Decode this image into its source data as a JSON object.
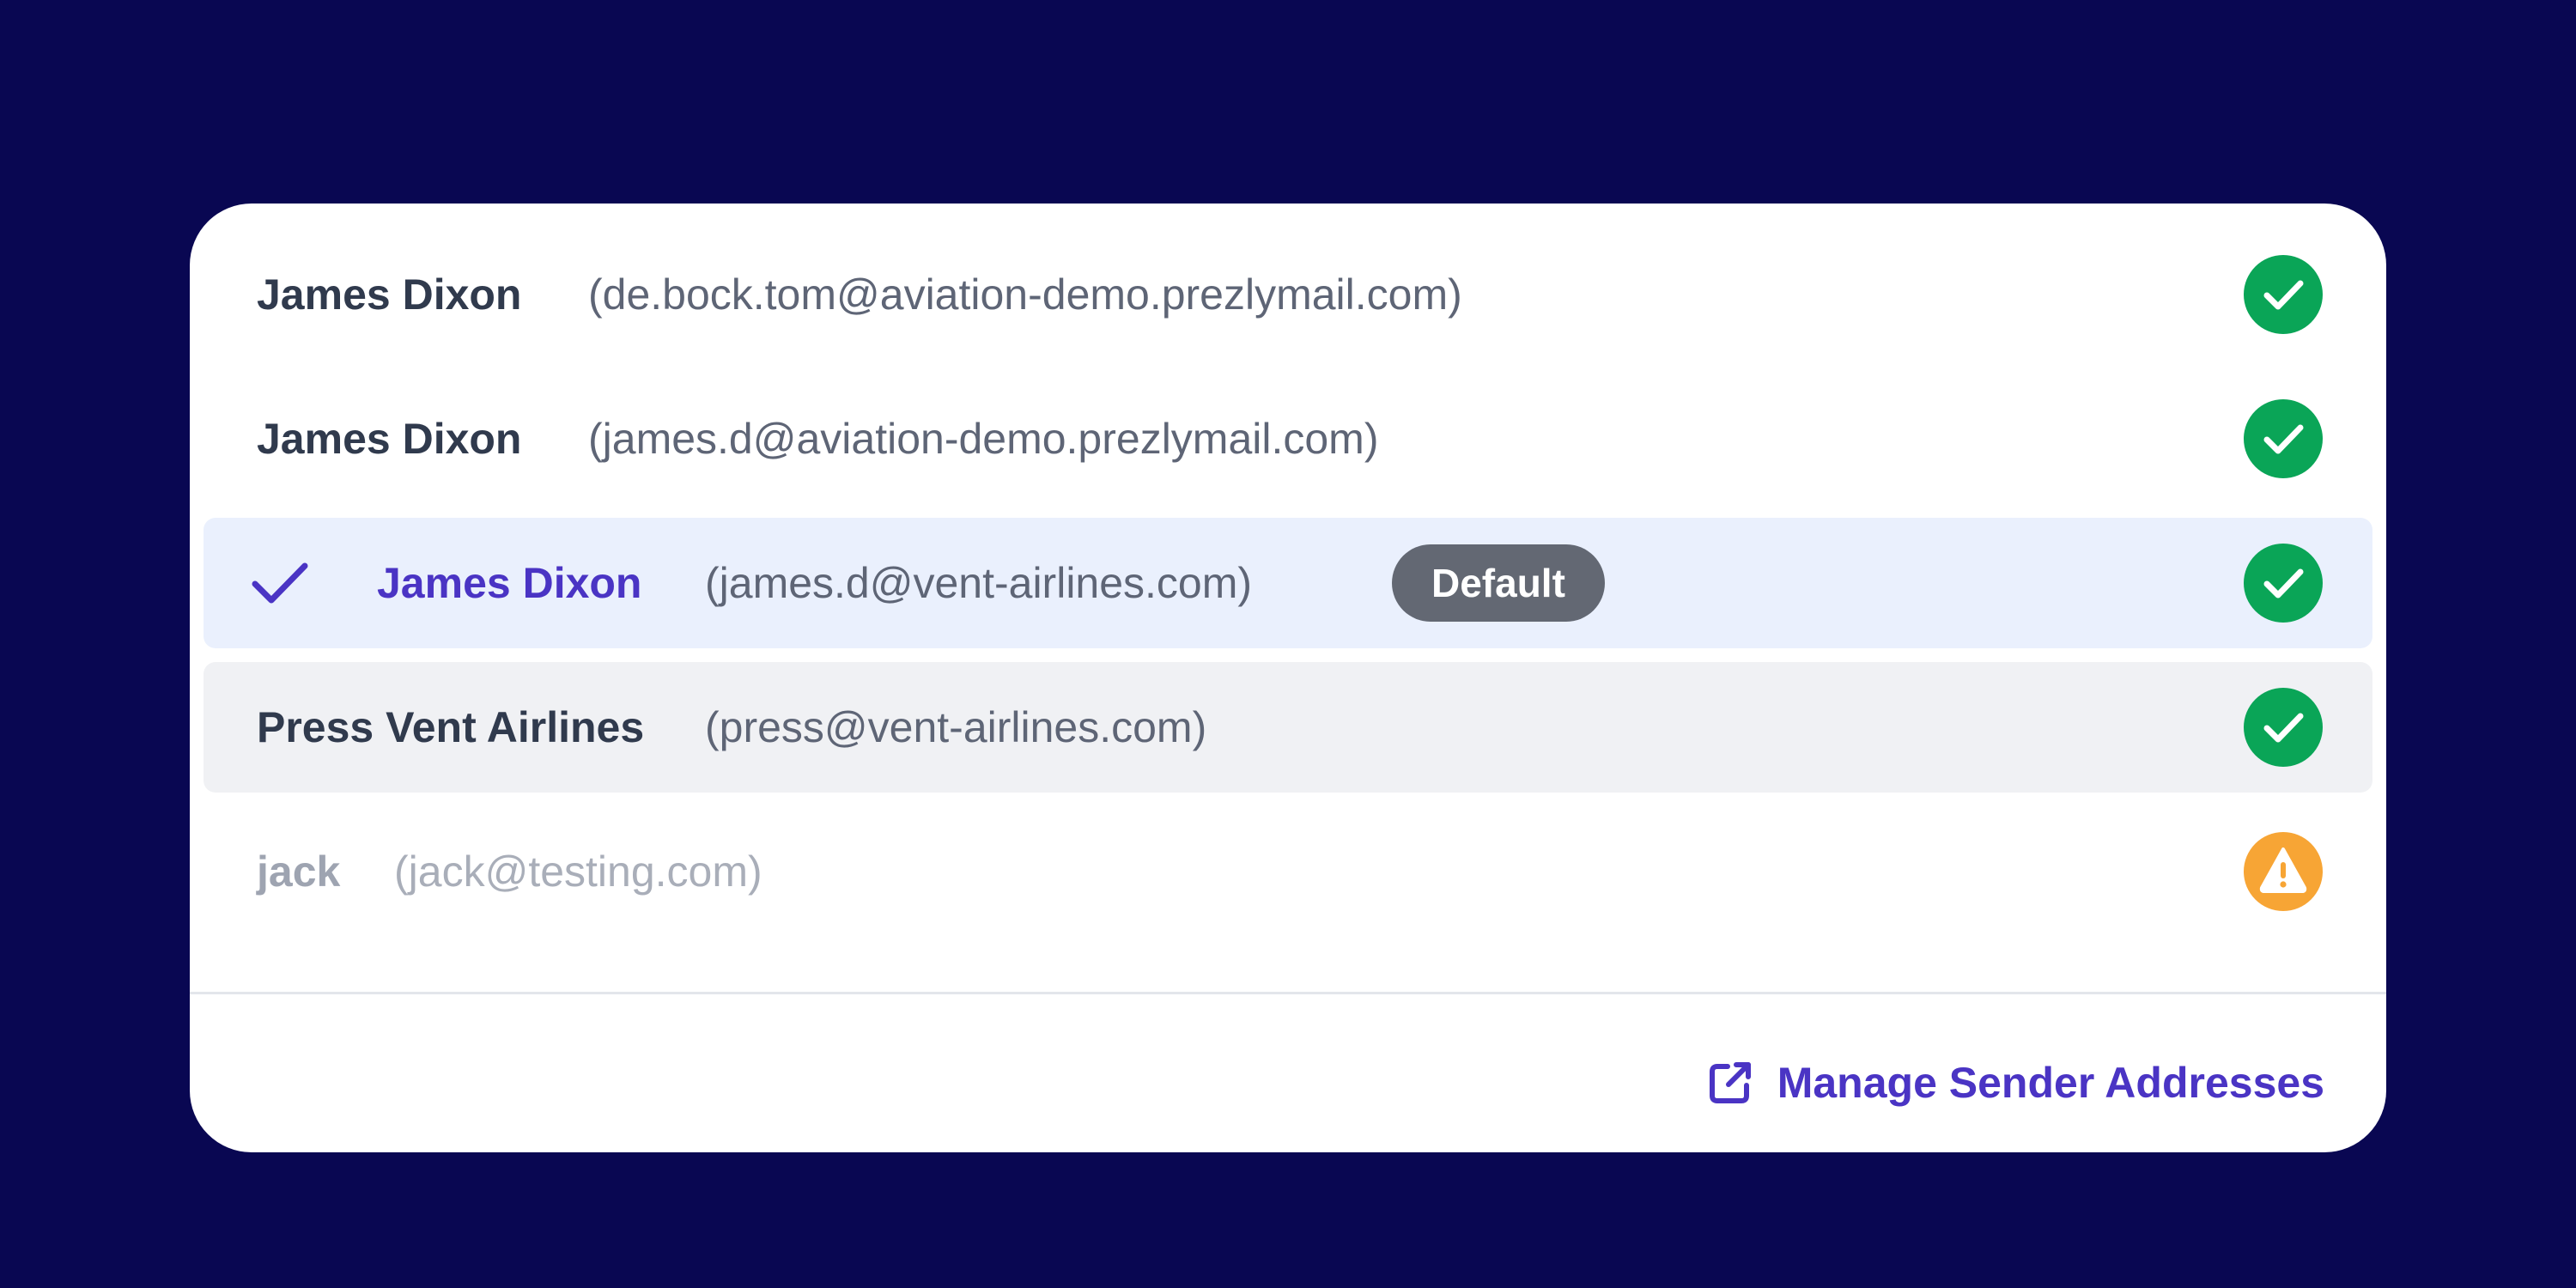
{
  "senders": [
    {
      "name": "James Dixon",
      "email": "(de.bock.tom@aviation-demo.prezlymail.com)",
      "status": "verified",
      "status_icon": "check-circle-icon"
    },
    {
      "name": "James Dixon",
      "email": "(james.d@aviation-demo.prezlymail.com)",
      "status": "verified",
      "status_icon": "check-circle-icon"
    },
    {
      "name": "James Dixon",
      "email": "(james.d@vent-airlines.com)",
      "status": "verified",
      "status_icon": "check-circle-icon",
      "selected": true,
      "badge": "Default"
    },
    {
      "name": "Press Vent Airlines",
      "email": "(press@vent-airlines.com)",
      "status": "verified",
      "status_icon": "check-circle-icon"
    },
    {
      "name": "jack",
      "email": "(jack@testing.com)",
      "status": "warning",
      "status_icon": "warning-triangle-icon"
    }
  ],
  "footer": {
    "manage_label": "Manage Sender Addresses",
    "manage_icon": "external-link-icon"
  },
  "colors": {
    "background": "#090752",
    "card": "#ffffff",
    "accent": "#4a34c4",
    "verified": "#0aa557",
    "warning": "#f7a535",
    "badge": "#636873",
    "selected_row": "#eaf0fd",
    "hover_row": "#f0f1f4"
  }
}
